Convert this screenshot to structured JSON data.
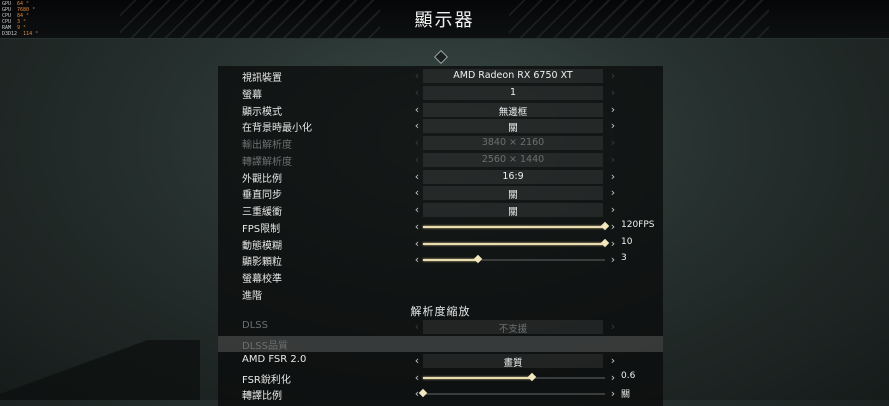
{
  "title": "顯示器",
  "perf_overlay": [
    {
      "label": "GPU",
      "value": "64 °"
    },
    {
      "label": "GPU",
      "value": "7680 °"
    },
    {
      "label": "CPU",
      "value": "84 °"
    },
    {
      "label": "CPU",
      "value": "3 °"
    },
    {
      "label": "RAM",
      "value": "9 °"
    },
    {
      "label": "D3D12",
      "value": "114 °"
    }
  ],
  "rows": [
    {
      "label": "視訊裝置",
      "value": "AMD Radeon RX 6750 XT",
      "left": false,
      "right": false,
      "dim": false
    },
    {
      "label": "螢幕",
      "value": "1",
      "left": false,
      "right": false,
      "dim": false
    },
    {
      "label": "顯示模式",
      "value": "無邊框",
      "left": true,
      "right": true,
      "dim": false
    },
    {
      "label": "在背景時最小化",
      "value": "關",
      "left": true,
      "right": true,
      "dim": false
    },
    {
      "label": "輸出解析度",
      "value": "3840 × 2160",
      "left": false,
      "right": false,
      "dim": true
    },
    {
      "label": "轉譯解析度",
      "value": "2560 × 1440",
      "left": false,
      "right": false,
      "dim": true
    },
    {
      "label": "外觀比例",
      "value": "16:9",
      "left": true,
      "right": true,
      "dim": false
    },
    {
      "label": "垂直同步",
      "value": "關",
      "left": true,
      "right": true,
      "dim": false
    },
    {
      "label": "三重緩衝",
      "value": "關",
      "left": true,
      "right": true,
      "dim": false
    },
    {
      "label": "FPS限制",
      "slider": 1.0,
      "value": "120FPS",
      "left": true,
      "right": true,
      "dim": false
    },
    {
      "label": "動態模糊",
      "slider": 1.0,
      "value": "10",
      "left": true,
      "right": true,
      "dim": false
    },
    {
      "label": "顯影顆粒",
      "slider": 0.3,
      "value": "3",
      "left": true,
      "right": true,
      "dim": false
    },
    {
      "label": "螢幕校準",
      "dim": false
    },
    {
      "label": "進階",
      "dim": false
    },
    {
      "section": "解析度縮放"
    },
    {
      "label": "DLSS",
      "value": "不支援",
      "left": false,
      "right": false,
      "dim": true
    },
    {
      "label": "DLSS品質",
      "dim": true,
      "highlight": true
    },
    {
      "label": "AMD FSR 2.0",
      "value": "畫質",
      "left": true,
      "right": true,
      "dim": false
    },
    {
      "label": "FSR銳利化",
      "slider": 0.6,
      "value": "0.6",
      "left": true,
      "right": true,
      "dim": false
    },
    {
      "label": "轉譯比例",
      "slider": 0.0,
      "value": "關",
      "left": true,
      "right": true,
      "dim": false
    }
  ]
}
